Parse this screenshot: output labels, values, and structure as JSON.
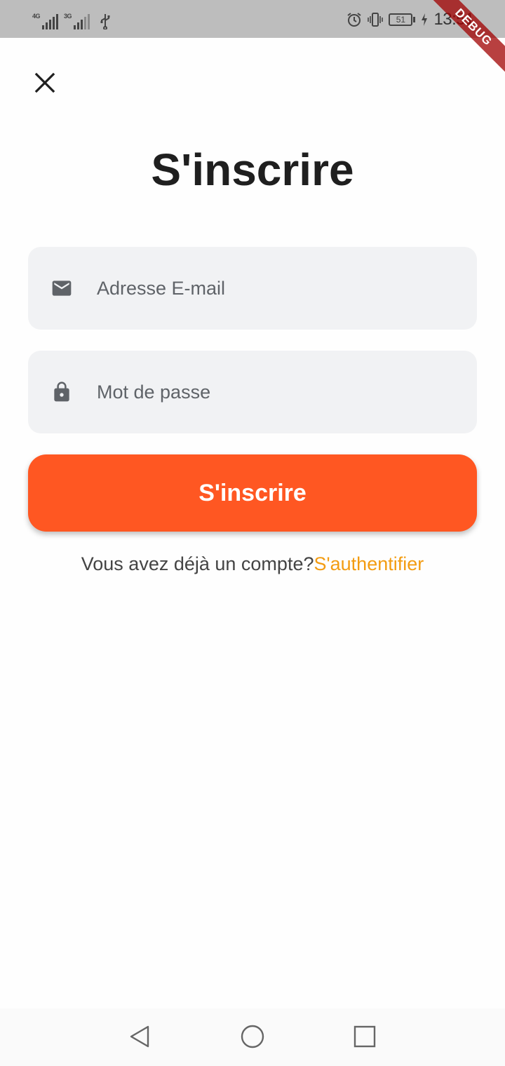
{
  "status_bar": {
    "network1_label": "4G",
    "network2_label": "3G",
    "battery_level": "51",
    "time": "13:51"
  },
  "debug_banner": "DEBUG",
  "title": "S'inscrire",
  "email_field": {
    "placeholder": "Adresse E-mail",
    "value": "",
    "icon": "email-icon"
  },
  "password_field": {
    "placeholder": "Mot de passe",
    "value": "",
    "icon": "lock-icon"
  },
  "submit_button": {
    "label": "S'inscrire",
    "color": "#ff5722"
  },
  "login_prompt": {
    "text": "Vous avez déjà un compte?",
    "link_label": "S'authentifier",
    "link_color": "#f39c12"
  },
  "nav_bar": {
    "icons": [
      "back-icon",
      "home-icon",
      "recents-icon"
    ]
  }
}
